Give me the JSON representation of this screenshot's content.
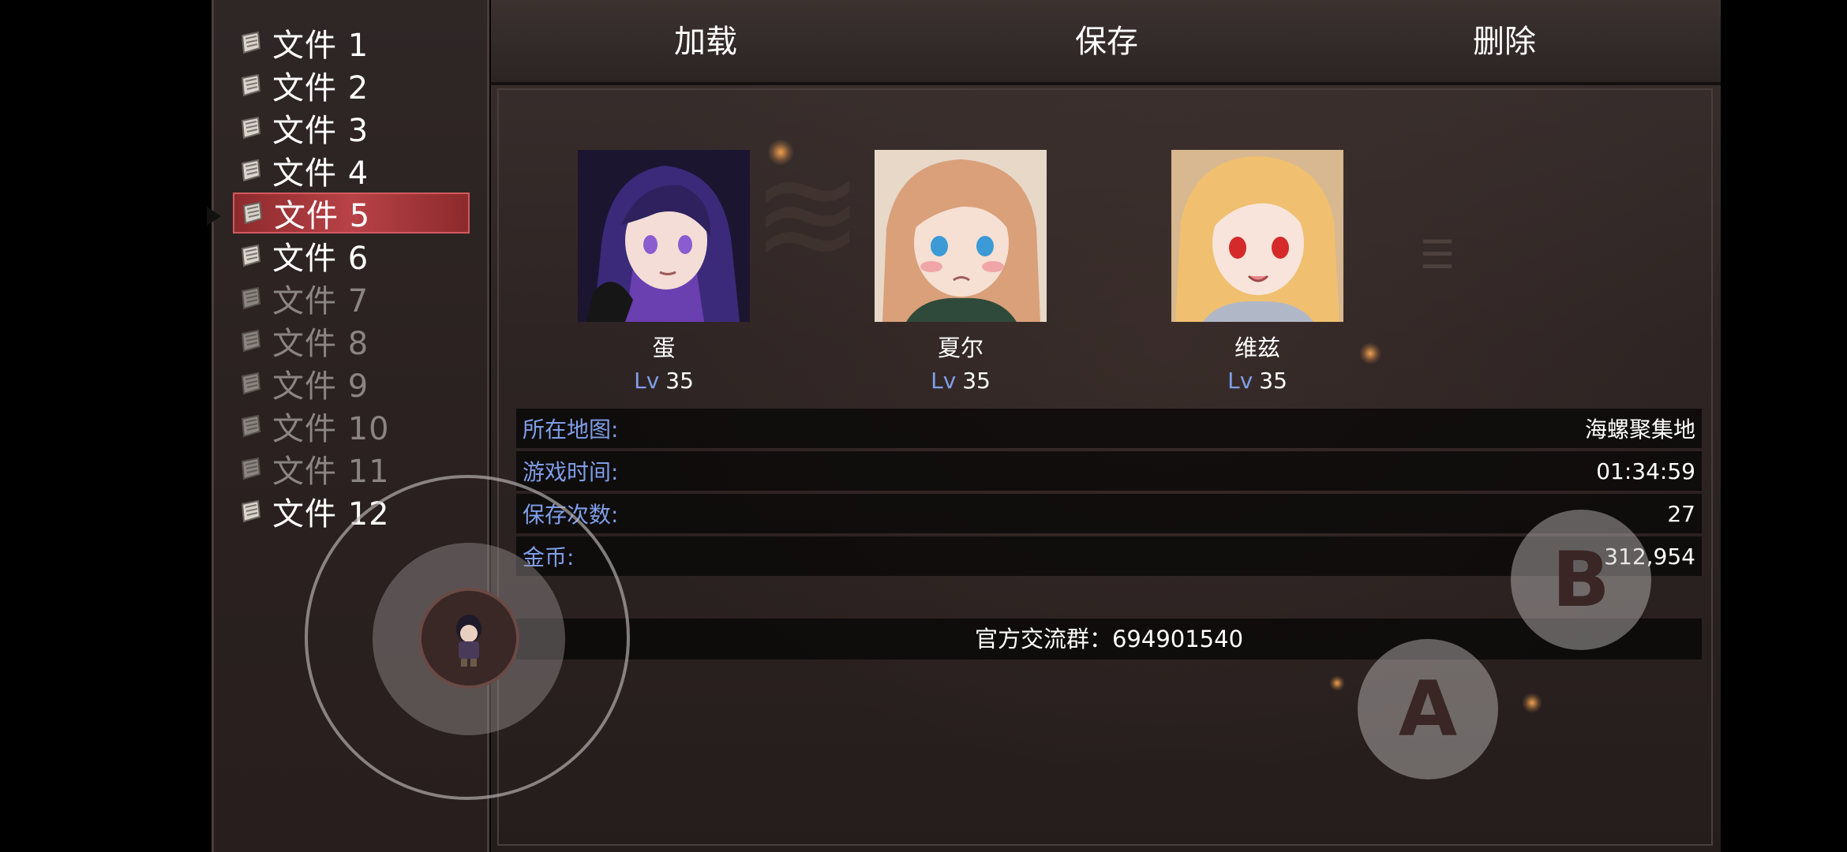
{
  "files": [
    {
      "label": "文件 1",
      "state": "filled"
    },
    {
      "label": "文件 2",
      "state": "filled"
    },
    {
      "label": "文件 3",
      "state": "filled"
    },
    {
      "label": "文件 4",
      "state": "filled"
    },
    {
      "label": "文件 5",
      "state": "selected"
    },
    {
      "label": "文件 6",
      "state": "filled"
    },
    {
      "label": "文件 7",
      "state": "empty"
    },
    {
      "label": "文件 8",
      "state": "empty"
    },
    {
      "label": "文件 9",
      "state": "empty"
    },
    {
      "label": "文件 10",
      "state": "empty"
    },
    {
      "label": "文件 11",
      "state": "empty"
    },
    {
      "label": "文件 12",
      "state": "filled"
    }
  ],
  "tabs": {
    "load": "加载",
    "save": "保存",
    "delete": "删除"
  },
  "party": [
    {
      "name": "蛋",
      "level_prefix": "Lv",
      "level": "35"
    },
    {
      "name": "夏尔",
      "level_prefix": "Lv",
      "level": "35"
    },
    {
      "name": "维兹",
      "level_prefix": "Lv",
      "level": "35"
    }
  ],
  "info": {
    "map_label": "所在地图:",
    "map_value": "海螺聚集地",
    "time_label": "游戏时间:",
    "time_value": "01:34:59",
    "save_count_label": "保存次数:",
    "save_count_value": "27",
    "gold_label": "金币:",
    "gold_value": "312,954"
  },
  "official_group": "官方交流群：694901540",
  "controls": {
    "a_button": "A",
    "b_button": "B"
  },
  "colors": {
    "selected_bg": "#b84247",
    "label_blue": "#7f9ee8",
    "empty_text": "#8a8482"
  }
}
